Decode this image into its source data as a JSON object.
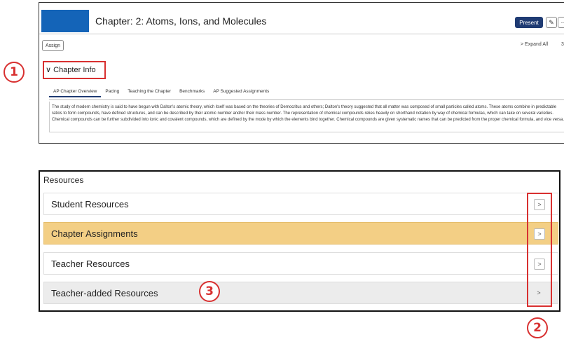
{
  "header": {
    "title": "Chapter: 2: Atoms, Ions, and Molecules",
    "present_label": "Present",
    "edit_glyph": "✎",
    "more_glyph": "···"
  },
  "toolbar": {
    "assign_label": "Assign",
    "expand_all_label": "> Expand All",
    "page_number": "3"
  },
  "chapter_info": {
    "label": "Chapter Info",
    "tabs": [
      "AP Chapter Overview",
      "Pacing",
      "Teaching the Chapter",
      "Benchmarks",
      "AP Suggested Assignments"
    ],
    "active_tab": "AP Chapter Overview",
    "overview_text": "The study of modern chemistry is said to have begun with Dalton's atomic theory, which itself was based on the theories of Democritus and others; Dalton's theory suggested that all matter was composed of small particles called atoms. These atoms combine in predictable ratios to form compounds, have defined structures, and can be described by their atomic number and/or their mass number. The representation of chemical compounds relies heavily on shorthand notation by way of chemical formulas, which can take on several varieties. Chemical compounds can be further subdivided into ionic and covalent compounds, which are defined by the mode by which the elements bind together. Chemical compounds are given systematic names that can be predicted from the proper chemical formula, and vice versa."
  },
  "resources": {
    "title": "Resources",
    "items": [
      {
        "label": "Student Resources"
      },
      {
        "label": "Chapter Assignments"
      },
      {
        "label": "Teacher Resources"
      },
      {
        "label": "Teacher-added Resources"
      }
    ],
    "chevron_glyph": ">"
  },
  "callouts": {
    "one": "1",
    "two": "2",
    "three": "3"
  },
  "colors": {
    "brand_blue": "#1464b8",
    "present_navy": "#1f3b73",
    "highlight_orange": "#f3cf85",
    "annotation_red": "#d83030"
  }
}
